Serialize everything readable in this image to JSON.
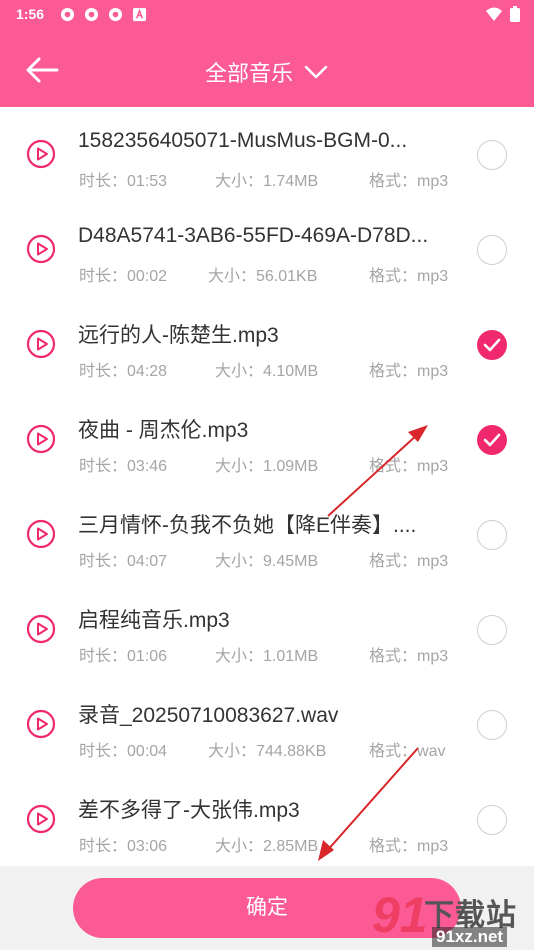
{
  "status_bar": {
    "time": "1:56"
  },
  "header": {
    "title": "全部音乐"
  },
  "labels": {
    "duration": "时长：",
    "size": "大小：",
    "format": "格式："
  },
  "songs": [
    {
      "name": "1582356405071-MusMus-BGM-0...",
      "duration": "01:53",
      "size": "1.74MB",
      "format": "mp3",
      "selected": false
    },
    {
      "name": "D48A5741-3AB6-55FD-469A-D78D...",
      "duration": "00:02",
      "size": "56.01KB",
      "format": "mp3",
      "selected": false
    },
    {
      "name": "远行的人-陈楚生.mp3",
      "duration": "04:28",
      "size": "4.10MB",
      "format": "mp3",
      "selected": true
    },
    {
      "name": "夜曲 - 周杰伦.mp3",
      "duration": "03:46",
      "size": "1.09MB",
      "format": "mp3",
      "selected": true
    },
    {
      "name": "三月情怀-负我不负她【降E伴奏】....",
      "duration": "04:07",
      "size": "9.45MB",
      "format": "mp3",
      "selected": false
    },
    {
      "name": "启程纯音乐.mp3",
      "duration": "01:06",
      "size": "1.01MB",
      "format": "mp3",
      "selected": false
    },
    {
      "name": "录音_20250710083627.wav",
      "duration": "00:04",
      "size": "744.88KB",
      "format": "wav",
      "selected": false
    },
    {
      "name": "差不多得了-大张伟.mp3",
      "duration": "03:06",
      "size": "2.85MB",
      "format": "mp3",
      "selected": false
    }
  ],
  "footer": {
    "confirm_label": "确定"
  },
  "watermark": {
    "logo_text": "下载站",
    "url": "91xz.net",
    "number": "91"
  },
  "colors": {
    "accent": "#fb5a95",
    "check": "#f0286e",
    "annotation_arrow": "#d9262a"
  }
}
